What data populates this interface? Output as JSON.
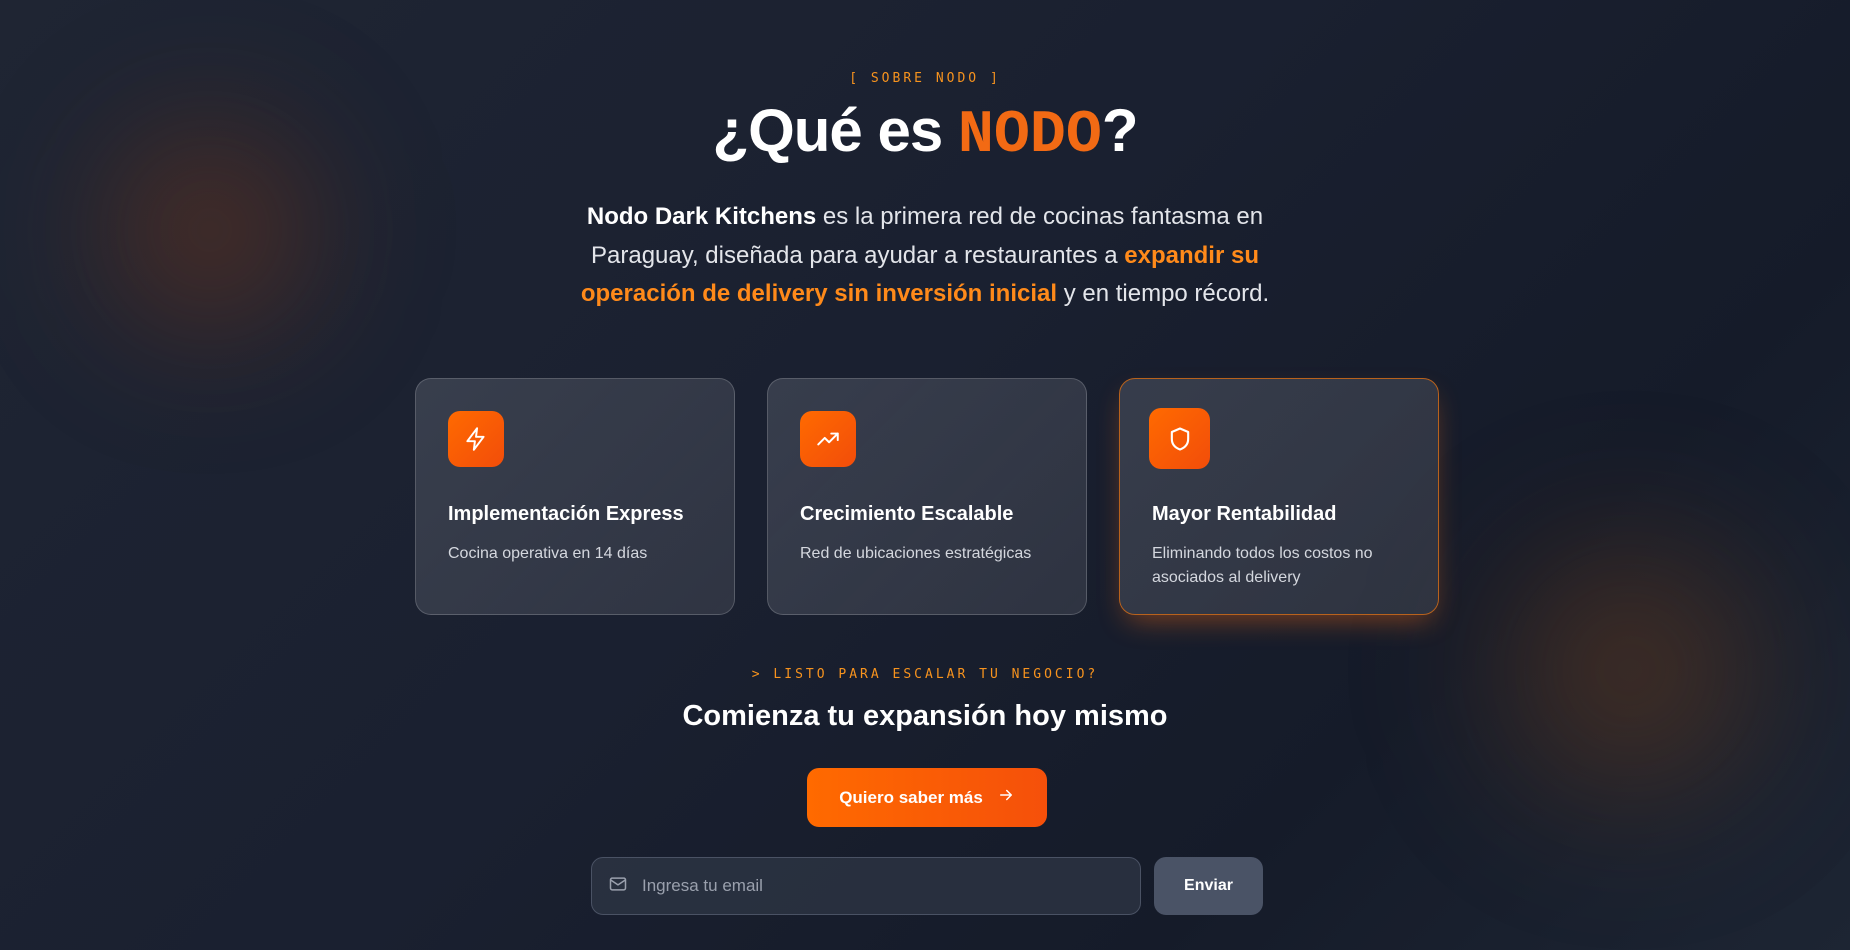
{
  "section_tag": "[ SOBRE NODO ]",
  "title": {
    "prefix": "¿Qué es ",
    "brand": "NODO",
    "suffix": "?"
  },
  "intro": {
    "bold": "Nodo Dark Kitchens",
    "part1": " es la primera red de cocinas fantasma en Paraguay, diseñada para ayudar a restaurantes a ",
    "highlight": "expandir su operación de delivery sin inversión inicial",
    "part2": " y en tiempo récord."
  },
  "features": [
    {
      "icon": "lightning-icon",
      "title": "Implementación Express",
      "desc": "Cocina operativa en 14 días"
    },
    {
      "icon": "trending-up-icon",
      "title": "Crecimiento Escalable",
      "desc": "Red de ubicaciones estratégicas"
    },
    {
      "icon": "shield-icon",
      "title": "Mayor Rentabilidad",
      "desc": "Eliminando todos los costos no asociados al delivery"
    }
  ],
  "cta": {
    "tag": "> LISTO PARA ESCALAR TU NEGOCIO?",
    "heading": "Comienza tu expansión hoy mismo",
    "button": "Quiero saber más",
    "email_placeholder": "Ingresa tu email",
    "email_value": "",
    "send": "Enviar"
  },
  "colors": {
    "accent": "#ff6a00",
    "highlight": "#ff8a1a",
    "background": "#1a2030"
  }
}
